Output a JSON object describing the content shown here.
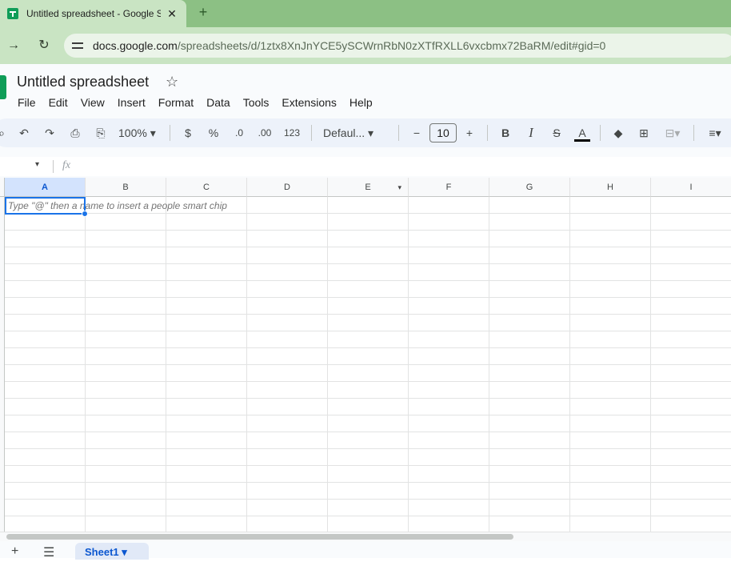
{
  "browser": {
    "tab_title": "Untitled spreadsheet - Google S",
    "tab_close": "✕",
    "new_tab": "+",
    "back": "→",
    "reload": "↻",
    "url_domain": "docs.google.com",
    "url_path": "/spreadsheets/d/1ztx8XnJnYCE5ySCWrnRbN0zXTfRXLL6vxcbmx72BaRM/edit#gid=0"
  },
  "doc": {
    "title": "Untitled spreadsheet",
    "star": "☆"
  },
  "menu": [
    "File",
    "Edit",
    "View",
    "Insert",
    "Format",
    "Data",
    "Tools",
    "Extensions",
    "Help"
  ],
  "toolbar": {
    "search": "⌕",
    "undo": "↶",
    "redo": "↷",
    "print": "⎙",
    "paint_format": "⎘",
    "zoom": "100%",
    "caret": "▾",
    "currency": "$",
    "percent": "%",
    "dec_decrease": ".0",
    "dec_increase": ".00",
    "number_format": "123",
    "font": "Defaul...",
    "minus": "−",
    "font_size": "10",
    "plus": "+",
    "bold": "B",
    "italic": "I",
    "strikethrough": "S",
    "text_color": "A",
    "fill": "◆",
    "borders": "⊞",
    "merge": "⊟",
    "align": "≡"
  },
  "formula_bar": {
    "namebox_caret": "▾",
    "fx": "fx"
  },
  "grid": {
    "columns": [
      "A",
      "B",
      "C",
      "D",
      "E",
      "F",
      "G",
      "H",
      "I"
    ],
    "selected_column": "A",
    "column_e_caret": "▾",
    "cell_hint": "Type \"@\" then a name to insert a people smart chip"
  },
  "sheets": {
    "add": "+",
    "all_sheets": "☰",
    "active_sheet": "Sheet1",
    "active_caret": "▾"
  }
}
